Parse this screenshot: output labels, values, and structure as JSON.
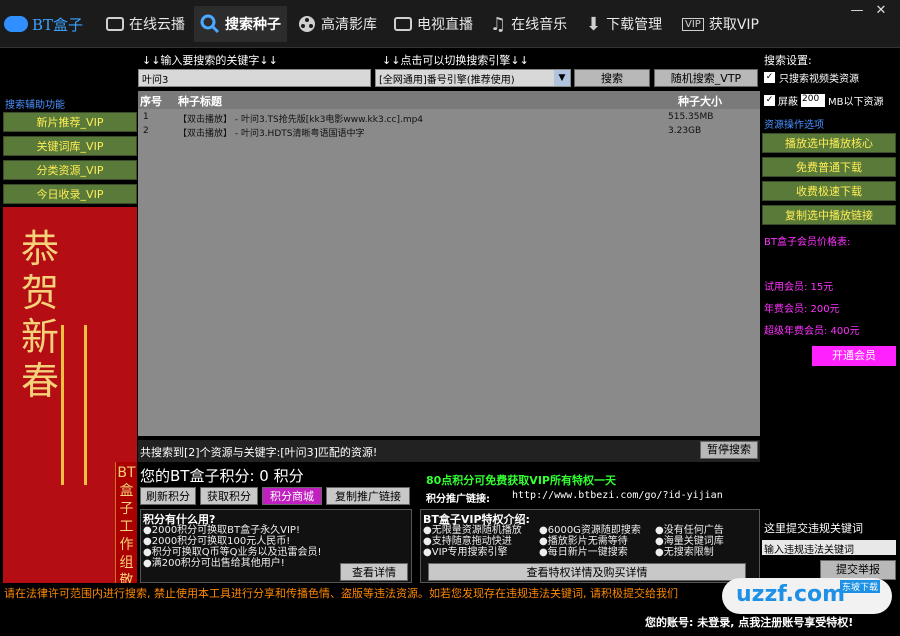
{
  "app": {
    "logo_text": "BT盒子"
  },
  "nav": [
    {
      "label": "在线云播",
      "icon": "play-box-icon"
    },
    {
      "label": "搜索种子",
      "icon": "search-icon",
      "active": true
    },
    {
      "label": "高清影库",
      "icon": "film-reel-icon"
    },
    {
      "label": "电视直播",
      "icon": "tv-play-icon"
    },
    {
      "label": "在线音乐",
      "icon": "music-note-icon"
    },
    {
      "label": "下载管理",
      "icon": "download-arrow-icon"
    },
    {
      "label": "获取VIP",
      "icon": "vip-icon"
    }
  ],
  "window": {
    "min": "—",
    "close": "✕"
  },
  "left": {
    "title": "搜索辅助功能",
    "buttons": [
      "新片推荐_VIP",
      "关键词库_VIP",
      "分类资源_VIP",
      "今日收录_VIP"
    ],
    "poster_big": "恭贺新春",
    "poster_vertical": "BT盒子工作组敬"
  },
  "search": {
    "hint_keyword": "↓↓输入要搜索的关键字↓↓",
    "hint_engine": "↓↓点击可以切换搜索引擎↓↓",
    "keyword": "叶问3",
    "engine": "[全网通用]番号引擎(推荐使用)",
    "search_btn": "搜索",
    "random_btn": "随机搜索_VTP"
  },
  "results": {
    "headers": [
      "序号",
      "种子标题",
      "种子大小"
    ],
    "rows": [
      {
        "no": "1",
        "title": "【双击播放】 - 叶问3.TS抢先版[kk3电影www.kk3.cc].mp4",
        "size": "515.35MB"
      },
      {
        "no": "2",
        "title": "【双击播放】 - 叶问3.HDTS清晰粤语国语中字",
        "size": "3.23GB"
      }
    ],
    "summary": "共搜索到[2]个资源与关键字:[叶问3]匹配的资源!",
    "pause_btn": "暂停搜索"
  },
  "points": {
    "title": "您的BT盒子积分: 0 积分",
    "promo": "80点积分可免费获取VIP所有特权一天",
    "buttons": [
      "刷新积分",
      "获取积分",
      "积分商城",
      "复制推广链接"
    ],
    "link_label": "积分推广链接:",
    "link": "http://www.btbezi.com/go/?id-yijian",
    "faq_title": "积分有什么用?",
    "faq_items": [
      "●2000积分可换取BT盒子永久VIP!",
      "●2000积分可换取100元人民币!",
      "●积分可换取Q币等Q业务以及迅雷会员!",
      "●满200积分可出售给其他用户!"
    ],
    "faq_btn": "查看详情",
    "vip_title": "BT盒子VIP特权介绍:",
    "vip_items": [
      "●无限量资源随机播放",
      "●6000G资源随即搜索",
      "●没有任何广告",
      "●支持随意拖动快进",
      "●播放影片无需等待",
      "●海量关键词库",
      "●VIP专用搜索引擎",
      "●每日新片一键搜索",
      "●无搜索限制"
    ],
    "vip_btn": "查看特权详情及购买详情"
  },
  "right": {
    "title": "搜索设置:",
    "opt1": "只搜索视频类资源",
    "opt2_prefix": "屏蔽",
    "opt2_value": "200",
    "opt2_suffix": "MB以下资源",
    "ops_title": "资源操作选项",
    "buttons": [
      "播放选中播放核心",
      "免费普通下载",
      "收费极速下载",
      "复制选中播放链接"
    ],
    "price_title": "BT盒子会员价格表:",
    "prices": [
      "试用会员: 15元",
      "年费会员: 200元",
      "超级年费会员: 400元"
    ],
    "open_btn": "开通会员",
    "report_label": "这里提交违规关键词",
    "report_placeholder": "输入违规违法关键词",
    "report_btn": "提交举报"
  },
  "footer": {
    "notice": "请在法律许可范围内进行搜索, 禁止使用本工具进行分享和传播色情、盗版等违法资源。如若您发现存在违规违法关键词, 请积极提交给我们",
    "account": "您的账号: 未登录, 点我注册账号享受特权!"
  },
  "watermark": {
    "text": "uzzf.com",
    "sub": "东坡下载"
  }
}
